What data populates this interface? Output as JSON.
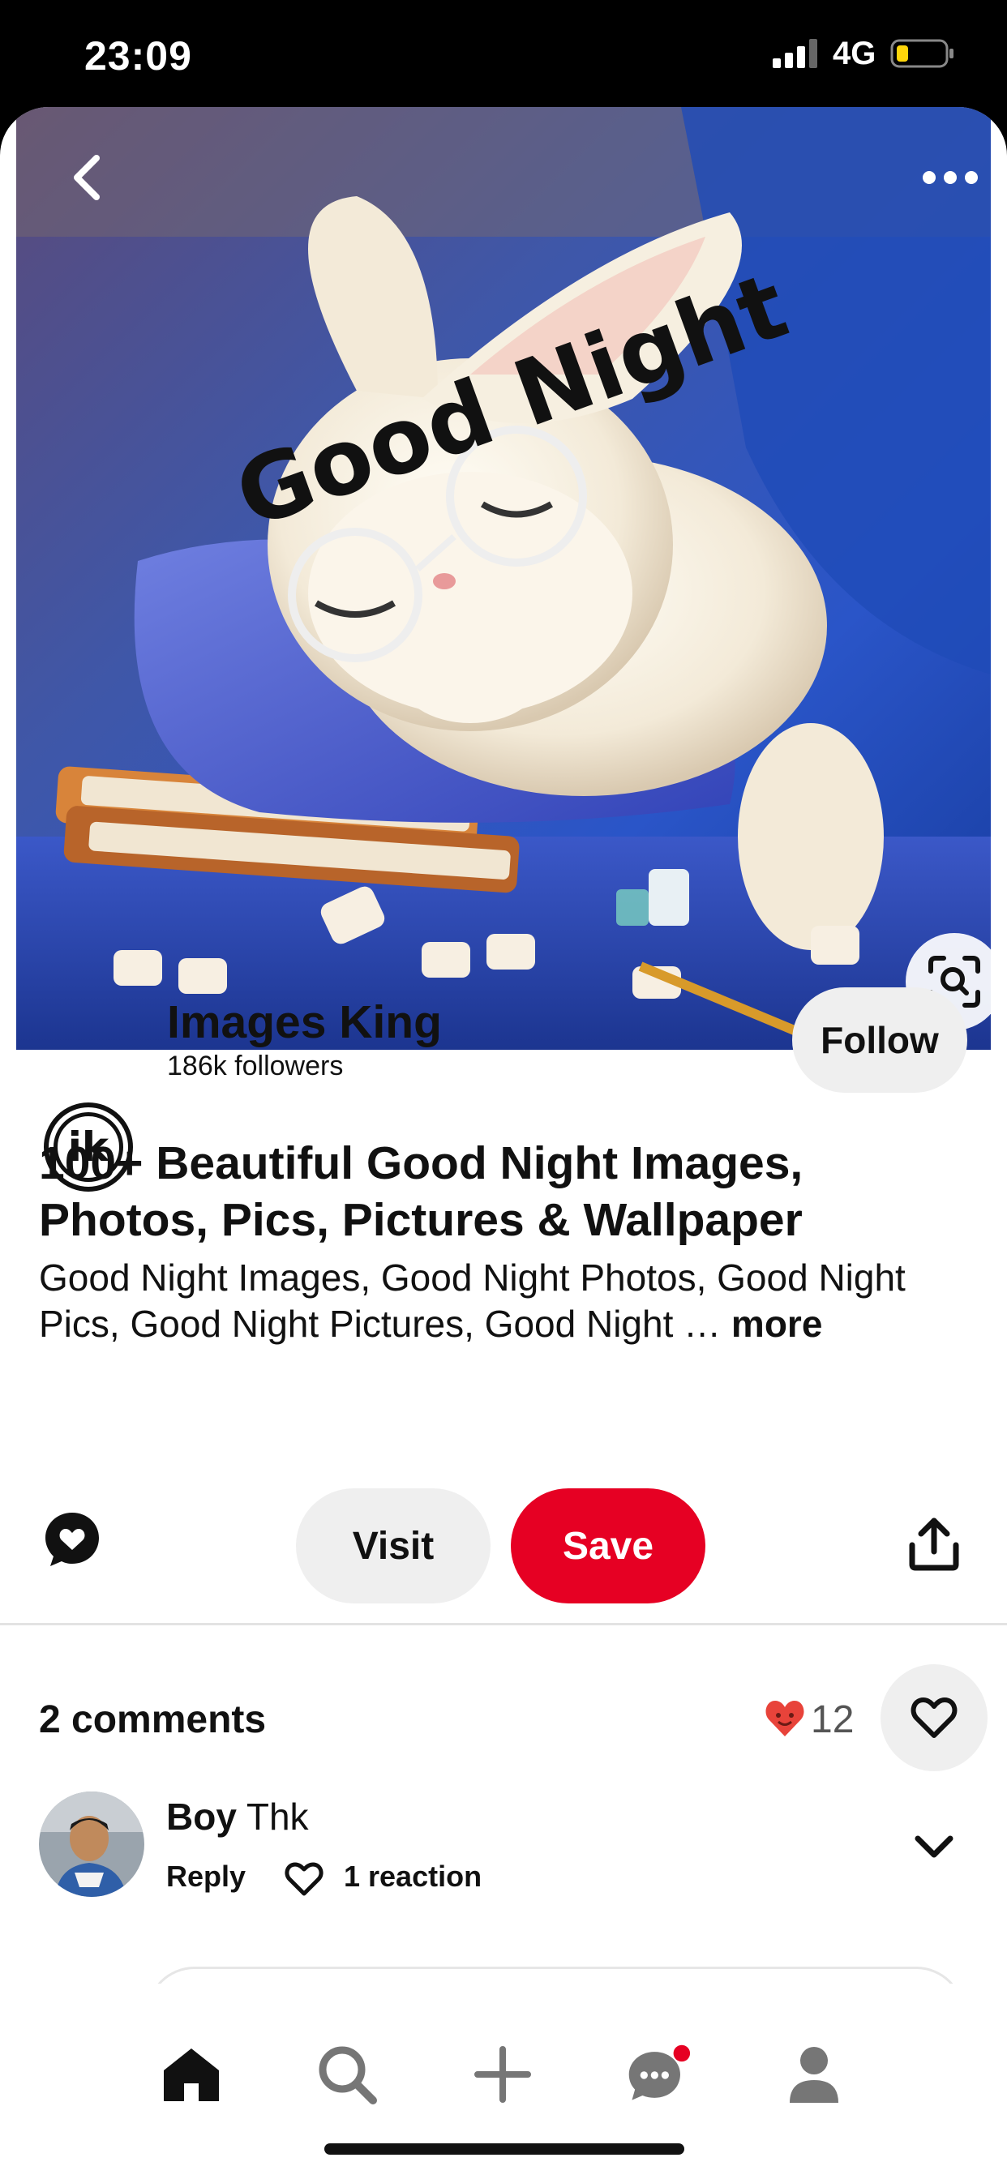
{
  "status_bar": {
    "time": "23:09",
    "network": "4G",
    "icons": [
      "signal-icon",
      "battery-low-icon"
    ]
  },
  "pin": {
    "image_text": "Good Night",
    "icons": [
      "back-chevron-icon",
      "more-dots-icon",
      "visual-search-icon"
    ]
  },
  "creator": {
    "name": "Images King",
    "followers": "186k followers",
    "avatar_letters": "ik",
    "follow_label": "Follow"
  },
  "title": "100+ Beautiful Good Night Images, Photos, Pics, Pictures & Wallpaper",
  "description": {
    "text": "Good Night Images, Good Night Photos, Good Night Pics, Good Night Pictures, Good Night … ",
    "more_label": "more"
  },
  "actions": {
    "visit_label": "Visit",
    "save_label": "Save",
    "save_color": "#e60023",
    "icons": [
      "comment-heart-icon",
      "share-icon"
    ]
  },
  "comments": {
    "count_label": "2 comments",
    "reaction_count": "12",
    "reaction_color": "#e60023",
    "items": [
      {
        "author_first": "Boy",
        "author_rest": "Thk",
        "reply_label": "Reply",
        "reactions_label": "1 reaction"
      }
    ]
  },
  "bottom_nav": {
    "items": [
      "home-icon",
      "search-icon",
      "plus-icon",
      "messages-icon",
      "profile-icon"
    ],
    "notification_color": "#e60023"
  }
}
